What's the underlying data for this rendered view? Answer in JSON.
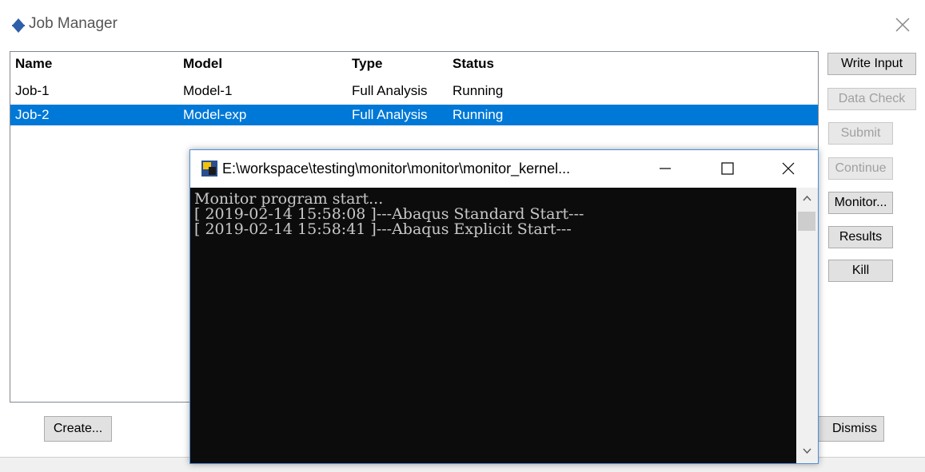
{
  "job_manager": {
    "title": "Job Manager",
    "columns": [
      "Name",
      "Model",
      "Type",
      "Status"
    ],
    "jobs": [
      {
        "name": "Job-1",
        "model": "Model-1",
        "type": "Full Analysis",
        "status": "Running"
      },
      {
        "name": "Job-2",
        "model": "Model-exp",
        "type": "Full Analysis",
        "status": "Running"
      }
    ],
    "selected_job": "Job-2",
    "buttons": {
      "write_input": "Write Input",
      "data_check": "Data Check",
      "submit": "Submit",
      "continue": "Continue",
      "monitor": "Monitor...",
      "results": "Results",
      "kill": "Kill",
      "create": "Create...",
      "dismiss": "Dismiss"
    },
    "colors": {
      "selection": "#0078d7"
    }
  },
  "console_window": {
    "title": "E:\\workspace\\testing\\monitor\\monitor\\monitor_kernel...",
    "lines": [
      "Monitor program start...",
      "[ 2019-02-14 15:58:08 ]---Abaqus Standard Start---",
      "[ 2019-02-14 15:58:41 ]---Abaqus Explicit Start---"
    ],
    "colors": {
      "background": "#0c0c0c",
      "text": "#c8c8c8"
    }
  }
}
